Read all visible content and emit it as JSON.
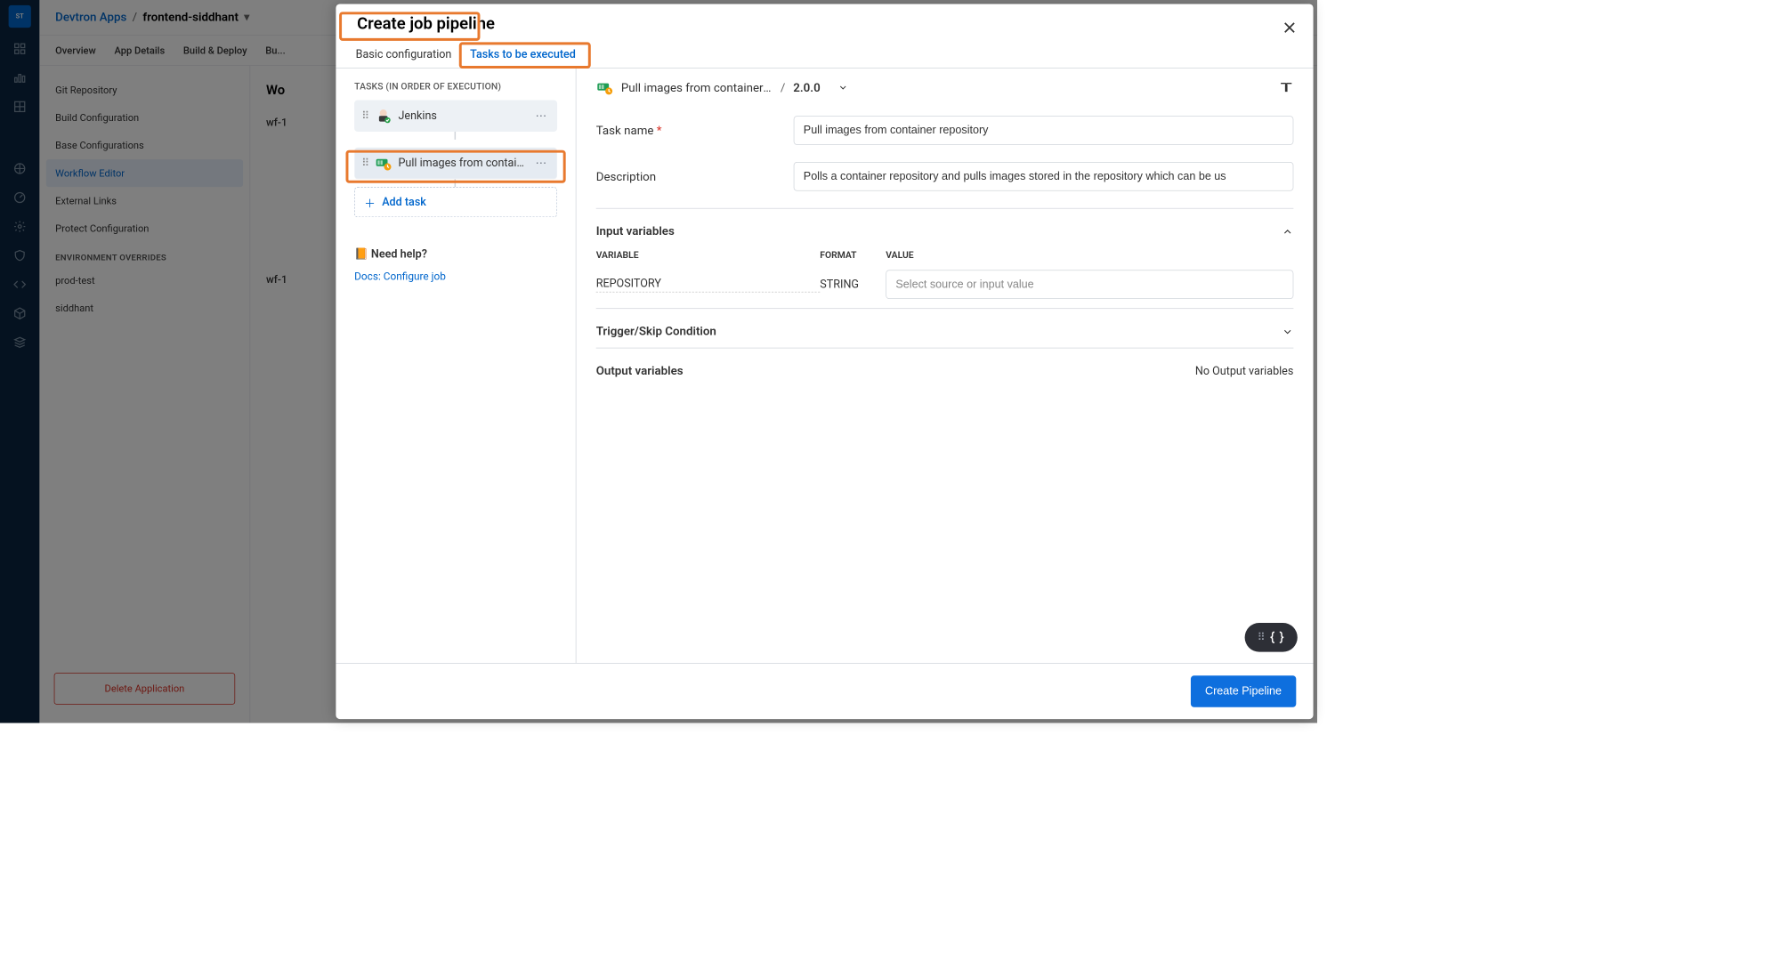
{
  "bg": {
    "breadcrumb_root": "Devtron Apps",
    "breadcrumb_current": "frontend-siddhant",
    "tabs": [
      "Overview",
      "App Details",
      "Build & Deploy",
      "Bu..."
    ],
    "side": {
      "items": [
        "Git Repository",
        "Build Configuration",
        "Base Configurations",
        "Workflow Editor",
        "External Links",
        "Protect Configuration"
      ],
      "env_label": "ENVIRONMENT OVERRIDES",
      "envs": [
        "prod-test",
        "siddhant"
      ],
      "delete": "Delete Application"
    },
    "main_title": "Wo",
    "wf1": "wf-1",
    "wf2": "wf-1"
  },
  "modal": {
    "title": "Create job pipeline",
    "tabs": {
      "basic": "Basic configuration",
      "tasks": "Tasks to be executed"
    },
    "tasks_label": "TASKS (IN ORDER OF EXECUTION)",
    "task_list": [
      {
        "label": "Jenkins"
      },
      {
        "label": "Pull images from contain…"
      }
    ],
    "add_task": "Add task",
    "need_help": "Need help?",
    "docs_link": "Docs: Configure job",
    "detail": {
      "name_trunc": "Pull images from container …",
      "version": "2.0.0",
      "task_name_label": "Task name",
      "task_name_value": "Pull images from container repository",
      "description_label": "Description",
      "description_value": "Polls a container repository and pulls images stored in the repository which can be us",
      "input_vars_label": "Input variables",
      "cols": {
        "variable": "VARIABLE",
        "format": "FORMAT",
        "value": "VALUE"
      },
      "vars": [
        {
          "name": "REPOSITORY",
          "format": "STRING",
          "placeholder": "Select source or input value"
        }
      ],
      "trigger_label": "Trigger/Skip Condition",
      "output_label": "Output variables",
      "output_none": "No Output variables"
    },
    "footer_btn": "Create Pipeline"
  }
}
